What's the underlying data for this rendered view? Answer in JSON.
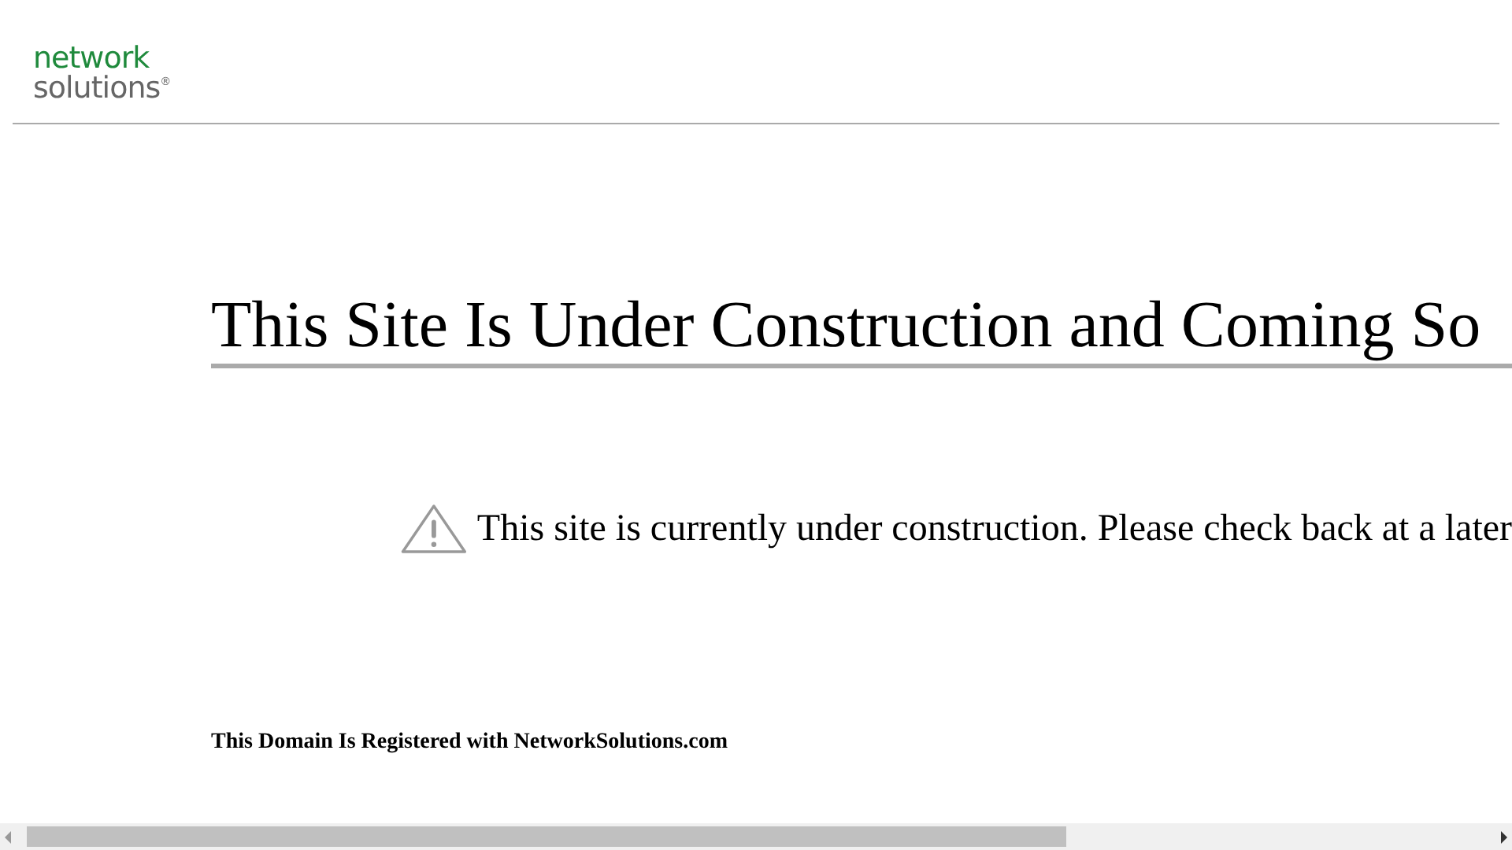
{
  "logo": {
    "line_1": "network",
    "line_2": "solutions",
    "mark": "®"
  },
  "heading": "This Site Is Under Construction and Coming So",
  "notice": "This site is currently under construction. Please check back at a later",
  "footer": "This Domain Is Registered with NetworkSolutions.com"
}
